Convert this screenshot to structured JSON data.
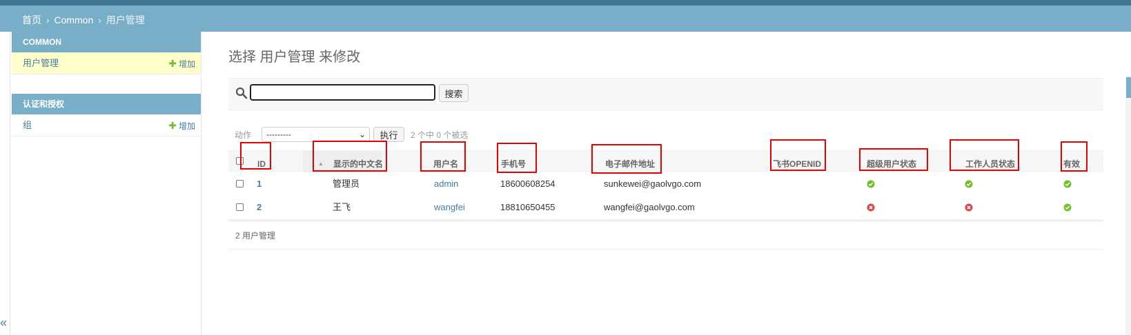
{
  "breadcrumbs": {
    "home": "首页",
    "section": "Common",
    "current": "用户管理",
    "sep": "›"
  },
  "sidebar": {
    "modules": [
      {
        "title": "COMMON",
        "items": [
          {
            "label": "用户管理",
            "add": "增加",
            "active": true
          }
        ]
      },
      {
        "title": "认证和授权",
        "items": [
          {
            "label": "组",
            "add": "增加",
            "active": false
          }
        ]
      }
    ],
    "collapse_glyph": "«"
  },
  "page": {
    "title": "选择 用户管理 来修改"
  },
  "search": {
    "value": "",
    "button": "搜索"
  },
  "actions": {
    "label": "动作",
    "selected": "---------",
    "execute": "执行",
    "counter": "2 个中 0 个被选"
  },
  "table": {
    "columns": [
      "ID",
      "显示的中文名",
      "用户名",
      "手机号",
      "电子邮件地址",
      "飞书OPENID",
      "超级用户状态",
      "工作人员状态",
      "有效"
    ],
    "rows": [
      {
        "id": "1",
        "display_name": "管理员",
        "username": "admin",
        "phone": "18600608254",
        "email": "sunkewei@gaolvgo.com",
        "feishu_openid": "",
        "is_superuser": true,
        "is_staff": true,
        "is_active": true
      },
      {
        "id": "2",
        "display_name": "王飞",
        "username": "wangfei",
        "phone": "18810650455",
        "email": "wangfei@gaolvgo.com",
        "feishu_openid": "",
        "is_superuser": false,
        "is_staff": false,
        "is_active": true
      }
    ]
  },
  "paginator": {
    "text": "2 用户管理"
  },
  "colors": {
    "header": "#79aec8",
    "top_strip": "#417690",
    "link": "#447e9b",
    "active_row": "#ffffcc",
    "yes": "#70bf2b",
    "no": "#dd4646",
    "highlight": "#e60000"
  },
  "icons": {
    "search": "magnifier-icon",
    "add": "plus-icon",
    "yes": "check-circle-icon",
    "no": "x-circle-icon",
    "sort": "sort-up-icon"
  }
}
